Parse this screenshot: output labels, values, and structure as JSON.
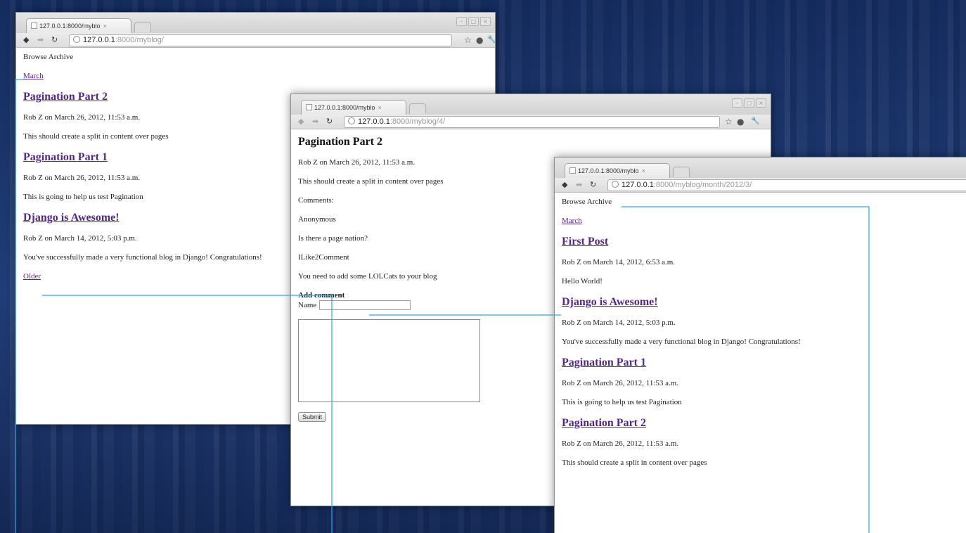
{
  "win1": {
    "tab_title": "127.0.0.1:8000/myblo",
    "tab_close": "×",
    "url_host": "127.0.0.1",
    "url_rest": ":8000/myblog/",
    "browse_archive": "Browse Archive",
    "archive_link": "March",
    "posts": [
      {
        "title": "Pagination Part 2",
        "meta": "Rob Z on March 26, 2012, 11:53 a.m.",
        "body": "This should create a split in content over pages"
      },
      {
        "title": "Pagination Part 1",
        "meta": "Rob Z on March 26, 2012, 11:53 a.m.",
        "body": "This is going to help us test Pagination"
      },
      {
        "title": "Django is Awesome!",
        "meta": "Rob Z on March 14, 2012, 5:03 p.m.",
        "body": "You've successfully made a very functional blog in Django! Congratulations!"
      }
    ],
    "older_link": "Older"
  },
  "win2": {
    "tab_title": "127.0.0.1:8000/myblo",
    "tab_close": "×",
    "url_host": "127.0.0.1",
    "url_rest": ":8000/myblog/4/",
    "post_title": "Pagination Part 2",
    "meta": "Rob Z on March 26, 2012, 11:53 a.m.",
    "body": "This should create a split in content over pages",
    "comments_label": "Comments:",
    "comments": [
      {
        "author": "Anonymous",
        "text": "Is there a page nation?"
      },
      {
        "author": "ILike2Comment",
        "text": "You need to add some LOLCats to your blog"
      }
    ],
    "add_comment_heading": "Add comment",
    "name_label": "Name",
    "submit_label": "Submit"
  },
  "win3": {
    "tab_title": "127.0.0.1:8000/myblo",
    "tab_close": "×",
    "url_host": "127.0.0.1",
    "url_rest": ":8000/myblog/month/2012/3/",
    "browse_archive": "Browse Archive",
    "archive_link": "March",
    "posts": [
      {
        "title": "First Post",
        "meta": "Rob Z on March 14, 2012, 6:53 a.m.",
        "body": "Hello World!"
      },
      {
        "title": "Django is Awesome!",
        "meta": "Rob Z on March 14, 2012, 5:03 p.m.",
        "body": "You've successfully made a very functional blog in Django! Congratulations!"
      },
      {
        "title": "Pagination Part 1",
        "meta": "Rob Z on March 26, 2012, 11:53 a.m.",
        "body": "This is going to help us test Pagination"
      },
      {
        "title": "Pagination Part 2",
        "meta": "Rob Z on March 26, 2012, 11:53 a.m.",
        "body": "This should create a split in content over pages"
      }
    ]
  },
  "icons": {
    "back": "◆",
    "forward": "➡",
    "reload": "↻",
    "star": "☆",
    "extension": "●",
    "wrench": "🔧",
    "minimize": "–",
    "maximize": "□",
    "close": "×"
  },
  "colors": {
    "link": "#55268f",
    "callout": "#29a9e8",
    "desktop": "#1f3a72"
  }
}
